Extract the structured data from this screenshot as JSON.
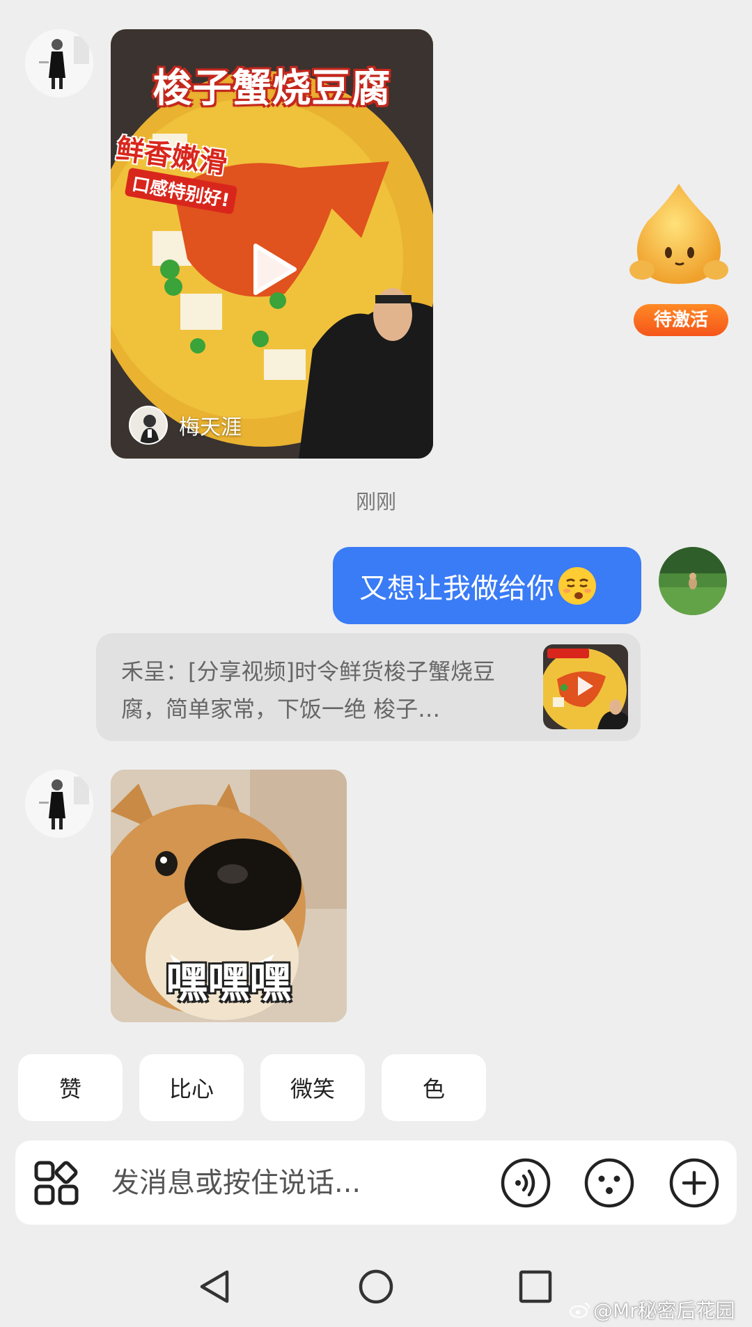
{
  "video_card": {
    "title": "梭子蟹烧豆腐",
    "subtitle_main": "鲜香嫩滑",
    "subtitle_small": "口感特别好!",
    "author": "梅天涯"
  },
  "mascot": {
    "badge_label": "待激活"
  },
  "timestamp": "刚刚",
  "sent_message": {
    "text": "又想让我做给你",
    "emoji": "smirk-emoji"
  },
  "share_card": {
    "text": "禾呈：[分享视频]时令鲜货梭子蟹烧豆腐，简单家常，下饭一绝 梭子…"
  },
  "meme": {
    "caption": "嘿嘿嘿"
  },
  "quick_replies": [
    {
      "label": "赞"
    },
    {
      "label": "比心"
    },
    {
      "label": "微笑"
    },
    {
      "label": "色"
    }
  ],
  "input_bar": {
    "placeholder": "发消息或按住说话..."
  },
  "watermark": "@Mr秘密后花园",
  "colors": {
    "accent": "#3a7bf6",
    "badge": "#f5551a",
    "background": "#eeeeee"
  }
}
